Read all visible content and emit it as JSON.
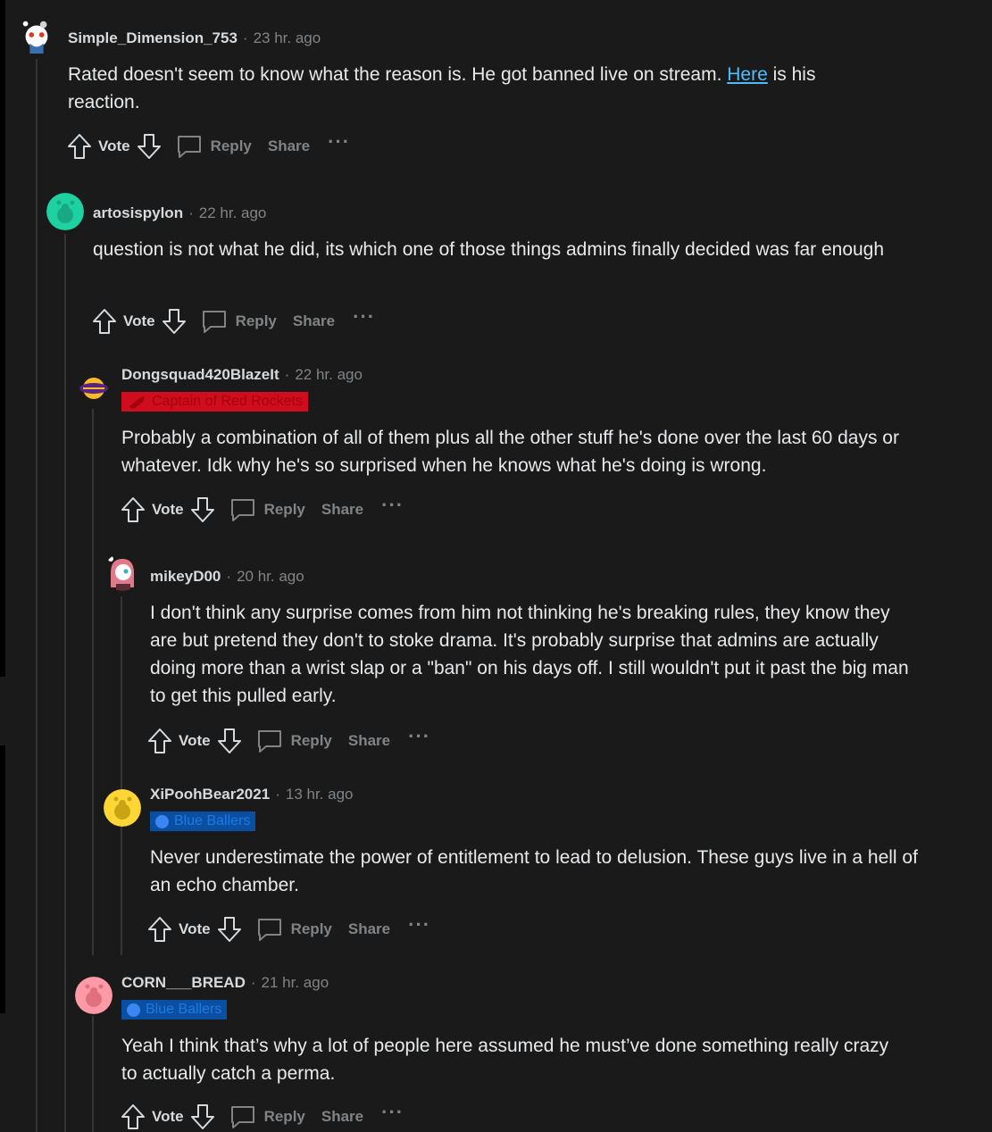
{
  "comments": [
    {
      "author": "Simple_Dimension_753",
      "time": "23 hr. ago",
      "body_pre": "Rated doesn't seem to know what the reason is. He got banned live on stream. ",
      "link": "Here",
      "body_post": " is his reaction.",
      "vote": "Vote",
      "reply": "Reply",
      "share": "Share",
      "more": "···"
    },
    {
      "author": "artosispylon",
      "time": "22 hr. ago",
      "body": "question is not what he did, its which one of those things admins finally decided was far enough",
      "vote": "Vote",
      "reply": "Reply",
      "share": "Share",
      "more": "···"
    },
    {
      "author": "Dongsquad420BlazeIt",
      "time": "22 hr. ago",
      "flair": "Captain of Red Rockets",
      "body": "Probably a combination of all of them plus all the other stuff he's done over the last 60 days or whatever. Idk why he's so surprised when he knows what he's doing is wrong.",
      "vote": "Vote",
      "reply": "Reply",
      "share": "Share",
      "more": "···"
    },
    {
      "author": "mikeyD00",
      "time": "20 hr. ago",
      "body": "I don't think any surprise comes from him not thinking he's breaking rules, they know they are but pretend they don't to stoke drama. It's probably surprise that admins are actually doing more than a wrist slap or a \"ban\" on his days off. I still wouldn't put it past the big man to get this pulled early.",
      "vote": "Vote",
      "reply": "Reply",
      "share": "Share",
      "more": "···"
    },
    {
      "author": "XiPoohBear2021",
      "time": "13 hr. ago",
      "flair": "Blue Ballers",
      "body": "Never underestimate the power of entitlement to lead to delusion. These guys live in a hell of an echo chamber.",
      "vote": "Vote",
      "reply": "Reply",
      "share": "Share",
      "more": "···"
    },
    {
      "author": "CORN___BREAD",
      "time": "21 hr. ago",
      "flair": "Blue Ballers",
      "body": "Yeah I think that’s why a lot of people here assumed he must’ve done something really crazy to actually catch a perma.",
      "vote": "Vote",
      "reply": "Reply",
      "share": "Share",
      "more": "···"
    }
  ],
  "separator": "·",
  "colors": {
    "background": "#1a1a1b",
    "author": "#d7dadc",
    "muted": "#818384",
    "link": "#4fbcff",
    "flair_red": "#d00d1e",
    "flair_blue": "#0b4fa3",
    "thread_line": "#343536"
  }
}
